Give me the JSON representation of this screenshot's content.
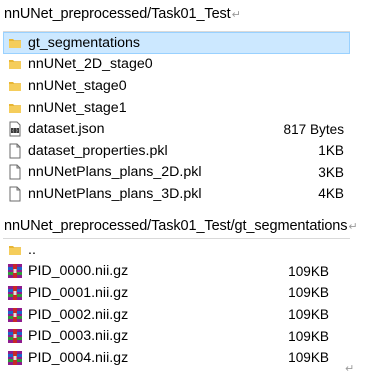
{
  "listing1": {
    "path": "nnUNet_preprocessed/Task01_Test",
    "items": [
      {
        "name": "gt_segmentations",
        "size": "",
        "icon": "folder-icon"
      },
      {
        "name": "nnUNet_2D_stage0",
        "size": "",
        "icon": "folder-icon"
      },
      {
        "name": "nnUNet_stage0",
        "size": "",
        "icon": "folder-icon"
      },
      {
        "name": "nnUNet_stage1",
        "size": "",
        "icon": "folder-icon"
      },
      {
        "name": "dataset.json",
        "size": "817 Bytes",
        "icon": "json-file-icon"
      },
      {
        "name": "dataset_properties.pkl",
        "size": "1KB",
        "icon": "file-icon"
      },
      {
        "name": "nnUNetPlans_plans_2D.pkl",
        "size": "3KB",
        "icon": "file-icon"
      },
      {
        "name": "nnUNetPlans_plans_3D.pkl",
        "size": "4KB",
        "icon": "file-icon"
      }
    ]
  },
  "listing2": {
    "path": "nnUNet_preprocessed/Task01_Test/gt_segmentations",
    "items": [
      {
        "name": "..",
        "size": "",
        "icon": "folder-icon"
      },
      {
        "name": "PID_0000.nii.gz",
        "size": "109KB",
        "icon": "archive-icon"
      },
      {
        "name": "PID_0001.nii.gz",
        "size": "109KB",
        "icon": "archive-icon"
      },
      {
        "name": "PID_0002.nii.gz",
        "size": "109KB",
        "icon": "archive-icon"
      },
      {
        "name": "PID_0003.nii.gz",
        "size": "109KB",
        "icon": "archive-icon"
      },
      {
        "name": "PID_0004.nii.gz",
        "size": "109KB",
        "icon": "archive-icon"
      }
    ]
  },
  "return_mark": "↵",
  "colors": {
    "folder": "#f2c94c",
    "selection": "#cce8ff",
    "archive_red": "#c62828"
  }
}
